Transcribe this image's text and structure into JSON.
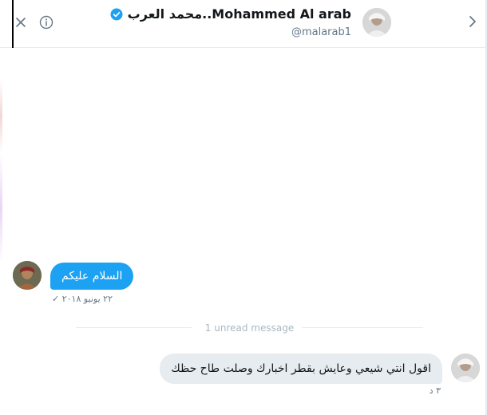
{
  "header": {
    "display_name": "محمد العرب..Mohammed Al arab",
    "handle": "@malarab1",
    "verified": true
  },
  "icons": {
    "close": "close-icon",
    "info": "info-icon",
    "back": "chevron-right-icon",
    "verified": "verified-badge-icon",
    "sent_check": "check-icon"
  },
  "colors": {
    "accent": "#1da1f2",
    "received_bubble": "#e6ecf0",
    "muted_text": "#657786"
  },
  "messages": [
    {
      "text": "السلام عليكم",
      "timestamp": "٢٢ يونيو ٢٠١٨",
      "status_mark": "✓"
    },
    {
      "text": "اقول انتي شيعي وعايش بقطر اخبارك وصلت طاح حظك",
      "timestamp": "٣ د"
    }
  ],
  "divider": {
    "label": "1 unread message"
  }
}
